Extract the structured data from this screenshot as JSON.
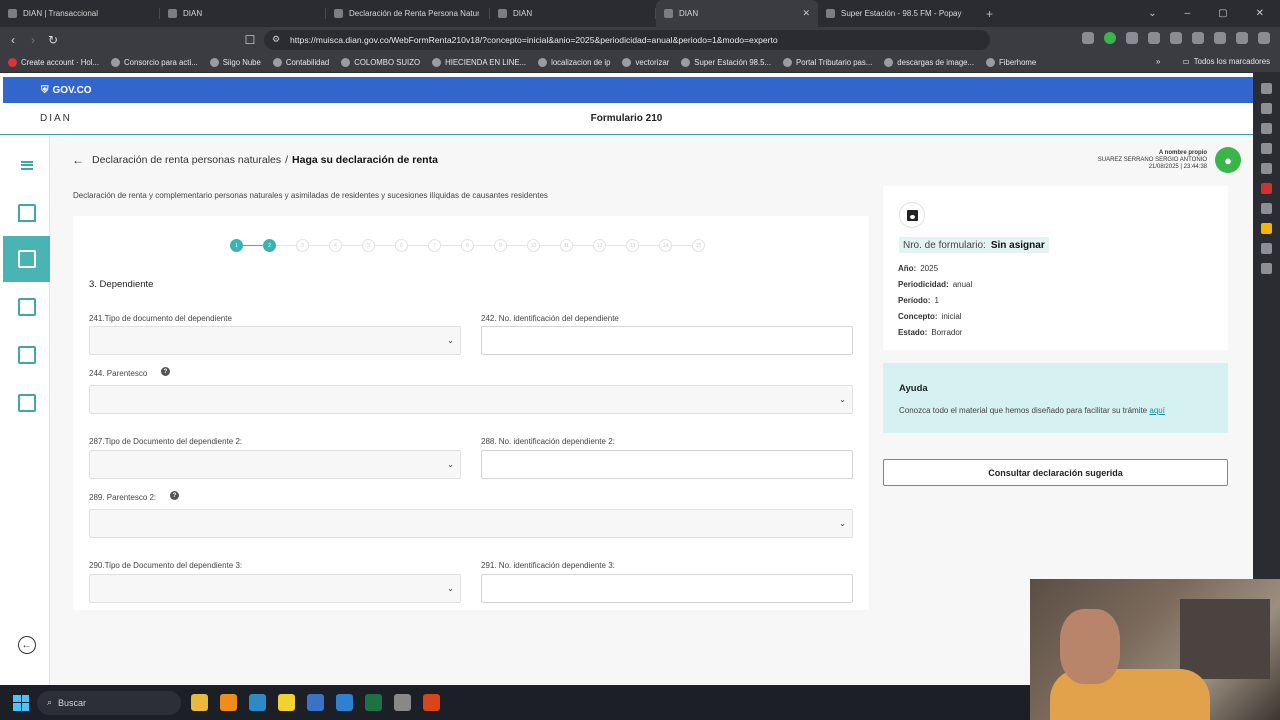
{
  "browser": {
    "tabs": [
      {
        "title": "DIAN | Transaccional",
        "active": false
      },
      {
        "title": "DIAN",
        "active": false
      },
      {
        "title": "Declaración de Renta Persona Natural",
        "active": false
      },
      {
        "title": "DIAN",
        "active": false
      },
      {
        "title": "DIAN",
        "active": true
      },
      {
        "title": "Super Estación - 98.5 FM - Popay",
        "active": false
      }
    ],
    "url": "https://muisca.dian.gov.co/WebFormRenta210v18/?concepto=inicial&anio=2025&periodicidad=anual&periodo=1&modo=experto",
    "bookmarks": [
      "Create account · Hol...",
      "Consorcio para acti...",
      "Siigo Nube",
      "Contabilidad",
      "COLOMBO SUIZO",
      "HIECIENDA EN LINE...",
      "localizacion de ip",
      "vectorizar",
      "Super Estación 98.5...",
      "Portal Tributario pas...",
      "descargas de image...",
      "Fiberhome"
    ],
    "all_bookmarks": "Todos los marcadores"
  },
  "gov": {
    "label": "GOV.CO"
  },
  "header": {
    "logo": "DIAN",
    "form_title": "Formulario 210"
  },
  "breadcrumb": {
    "parent": "Declaración de renta personas naturales",
    "separator": "/",
    "current": "Haga su declaración de renta"
  },
  "user": {
    "line1": "A nombre propio",
    "line2": "SUAREZ SERRANO SERGIO ANTONIO",
    "line3": "21/08/2025 | 23:44:38"
  },
  "description": "Declaración de renta y complementario personas naturales y asimiladas de residentes y sucesiones ilíquidas de causantes residentes",
  "stepper": {
    "steps": [
      "1",
      "2",
      "3",
      "4",
      "5",
      "6",
      "7",
      "8",
      "9",
      "10",
      "11",
      "12",
      "13",
      "14",
      "15"
    ],
    "current": 2
  },
  "section": {
    "title": "3. Dependiente"
  },
  "fields": {
    "f241": "241.Tipo de documento del dependiente",
    "f242": "242. No. identificación del dependiente",
    "f244": "244. Parentesco",
    "f287": "287.Tipo de Documento del dependiente 2:",
    "f288": "288. No. identificación dependiente 2:",
    "f289": "289. Parentesco 2:",
    "f290": "290.Tipo de Documento del dependiente 3:",
    "f291": "291. No. identificación dependiente 3:"
  },
  "side": {
    "nro_label": "Nro. de formulario:",
    "nro_value": "Sin asignar",
    "anio_label": "Año:",
    "anio_value": "2025",
    "periodicidad_label": "Periodicidad:",
    "periodicidad_value": "anual",
    "periodo_label": "Período:",
    "periodo_value": "1",
    "concepto_label": "Concepto:",
    "concepto_value": "inicial",
    "estado_label": "Estado:",
    "estado_value": "Borrador"
  },
  "help": {
    "title": "Ayuda",
    "text": "Conozca todo el material que hemos diseñado para facilitar su trámite",
    "link": "aquí"
  },
  "suggest_button": "Consultar declaración sugerida",
  "taskbar": {
    "search": "Buscar"
  },
  "colors": {
    "teal": "#39b3b3",
    "gov_blue": "#3366cc",
    "green": "#3ab54a",
    "help_bg": "#d6f1f1"
  }
}
